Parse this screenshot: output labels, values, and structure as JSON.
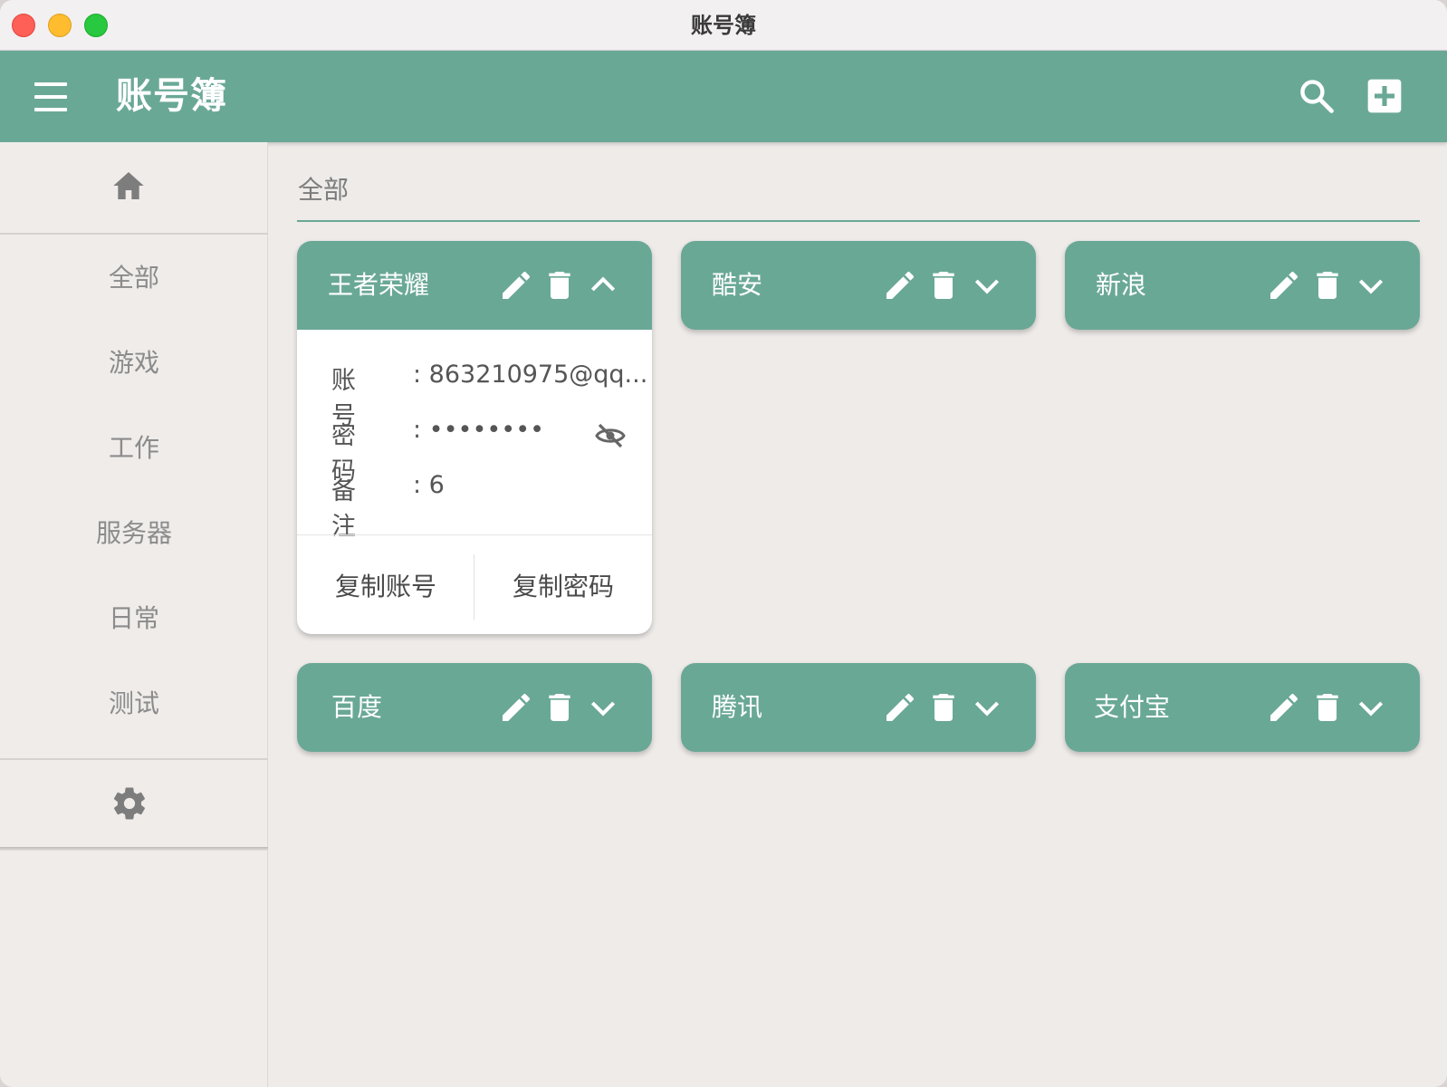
{
  "window": {
    "title": "账号簿"
  },
  "appbar": {
    "title": "账号簿"
  },
  "sidebar": {
    "items": [
      {
        "label": "全部"
      },
      {
        "label": "游戏"
      },
      {
        "label": "工作"
      },
      {
        "label": "服务器"
      },
      {
        "label": "日常"
      },
      {
        "label": "测试"
      }
    ]
  },
  "section": {
    "title": "全部"
  },
  "cards": [
    {
      "title": "王者荣耀",
      "expanded": true,
      "account_label": "账号",
      "account_value": ": 863210975@qq...",
      "password_label": "密码",
      "password_value": ": ••••••••",
      "note_label": "备注",
      "note_value": ": 6",
      "copy_account": "复制账号",
      "copy_password": "复制密码"
    },
    {
      "title": "酷安"
    },
    {
      "title": "新浪"
    },
    {
      "title": "百度"
    },
    {
      "title": "腾讯"
    },
    {
      "title": "支付宝"
    }
  ],
  "colors": {
    "accent": "#6aa896",
    "background": "#eeebe9"
  }
}
